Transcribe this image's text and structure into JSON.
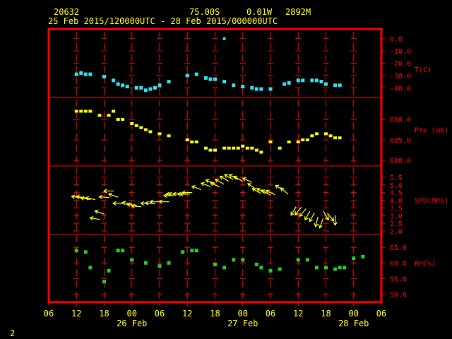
{
  "header": {
    "station": "20632",
    "lat": "75.00S",
    "lon": "0.01W",
    "alt": "2892M",
    "period": "25 Feb 2015/120000UTC - 28 Feb 2015/000000UTC"
  },
  "footer_label": "2",
  "colors": {
    "frame": "#ff0000",
    "grid": "#ff0000",
    "axis_text": "#ff0000",
    "header_text": "#ffff00",
    "temp": "#33ddee",
    "pres": "#ffff00",
    "wind": "#ffff00",
    "rh": "#22cc22"
  },
  "chart_data": {
    "type": "scatter",
    "x_hours": [
      -18,
      -12,
      -6,
      0,
      6,
      12,
      18,
      24,
      30,
      36,
      42,
      48,
      54
    ],
    "x_tick_labels": [
      "06",
      "12",
      "18",
      "00",
      "06",
      "12",
      "18",
      "00",
      "06",
      "12",
      "18",
      "00",
      "06"
    ],
    "date_labels": [
      {
        "hours": 0,
        "text": "26 Feb"
      },
      {
        "hours": 24,
        "text": "27 Feb"
      },
      {
        "hours": 48,
        "text": "28 Feb"
      }
    ],
    "panels": [
      {
        "label": "T(C)",
        "ylim": [
          -45,
          5
        ],
        "ticks": [
          0.0,
          -10.0,
          -20.0,
          -30.0,
          -40.0
        ],
        "series": {
          "x": [
            -12,
            -11,
            -10,
            -9,
            -6,
            -4,
            -3,
            -2,
            -1,
            1,
            2,
            3,
            4,
            5,
            6,
            8,
            12,
            14,
            16,
            17,
            18,
            20,
            22,
            24,
            26,
            27,
            28,
            30,
            33,
            34,
            36,
            37,
            39,
            40,
            41,
            42,
            44,
            45
          ],
          "y": [
            -29,
            -28,
            -29,
            -29,
            -31,
            -34,
            -37,
            -38,
            -39,
            -40,
            -40,
            -42,
            -41,
            -40,
            -38,
            -35,
            -30,
            -29,
            -32,
            -33,
            -33,
            -35,
            -38,
            -39,
            -40,
            -41,
            -41,
            -41,
            -37,
            -36,
            -34,
            -34,
            -34,
            -34,
            -35,
            -37,
            -38,
            -38
          ]
        },
        "outlier": {
          "x": 20,
          "y": 0
        }
      },
      {
        "label": "Pre (mb)",
        "ylim": [
          679.5,
          694.5
        ],
        "ticks": [
          690.0,
          685.0,
          680.0
        ],
        "series": {
          "x": [
            -12,
            -11,
            -10,
            -9,
            -7,
            -5,
            -4,
            -3,
            -2,
            0,
            1,
            2,
            3,
            4,
            6,
            8,
            12,
            13,
            14,
            16,
            17,
            18,
            20,
            21,
            22,
            23,
            24,
            25,
            26,
            27,
            28,
            30,
            32,
            34,
            36,
            37,
            38,
            39,
            40,
            42,
            43,
            44,
            45
          ],
          "y": [
            692,
            692,
            692,
            692,
            691,
            691,
            692,
            690,
            690,
            689,
            688.5,
            688,
            687.5,
            687,
            686.5,
            686,
            685,
            684.5,
            684.5,
            683,
            682.5,
            682.5,
            683,
            683,
            683,
            683,
            683.5,
            683,
            683,
            682.5,
            682,
            684.5,
            683,
            684.5,
            684.5,
            685,
            685,
            686,
            686.5,
            686.5,
            686,
            685.5,
            685.5
          ]
        }
      },
      {
        "label": "SPD(MPS)",
        "ylim": [
          2.0,
          6.0
        ],
        "ticks": [
          5.5,
          5.0,
          4.5,
          4.0,
          3.5,
          3.0,
          2.5,
          2.0
        ],
        "wind_note": "direction_deg = direction the wind blows from (meteorological)",
        "series": {
          "x": [
            -12,
            -11,
            -10,
            -9,
            -8,
            -7,
            -6,
            -5,
            -4,
            -3,
            -1,
            0,
            1,
            3,
            4,
            5,
            7,
            8,
            8.5,
            9,
            10,
            11,
            11.5,
            12,
            14,
            16,
            17,
            18,
            19,
            20,
            21,
            22,
            23,
            25,
            26,
            27,
            28,
            29,
            30,
            32,
            33,
            35,
            36,
            37,
            38,
            39,
            40,
            41,
            42,
            43,
            44
          ],
          "y": [
            4.2,
            4.2,
            4.1,
            4.1,
            2.8,
            3.2,
            4.2,
            4.6,
            4.3,
            3.8,
            3.8,
            3.7,
            3.6,
            3.8,
            3.8,
            3.9,
            3.9,
            4.3,
            4.4,
            4.4,
            4.4,
            4.4,
            4.4,
            4.5,
            4.8,
            5.0,
            5.2,
            5.0,
            5.2,
            5.4,
            5.5,
            5.5,
            5.4,
            5.3,
            4.9,
            4.6,
            4.6,
            4.5,
            4.5,
            4.8,
            4.6,
            3.3,
            3.3,
            3.2,
            3.0,
            2.9,
            2.6,
            2.5,
            3.0,
            2.9,
            2.7
          ],
          "direction_deg": [
            100,
            100,
            100,
            100,
            100,
            110,
            95,
            90,
            110,
            90,
            100,
            95,
            95,
            90,
            95,
            90,
            90,
            90,
            90,
            90,
            90,
            90,
            90,
            90,
            110,
            110,
            110,
            115,
            120,
            120,
            120,
            120,
            120,
            115,
            125,
            120,
            120,
            120,
            115,
            120,
            130,
            30,
            40,
            40,
            30,
            30,
            15,
            20,
            330,
            320,
            0
          ]
        }
      },
      {
        "label": "RH(%)",
        "ylim": [
          48.5,
          68.0
        ],
        "ticks": [
          65.0,
          60.0,
          55.0,
          50.0
        ],
        "series": {
          "x": [
            -12,
            -10,
            -9,
            -6,
            -5,
            -3,
            -2,
            0,
            3,
            6,
            8,
            11,
            13,
            14,
            18,
            20,
            22,
            24,
            27,
            28,
            30,
            32,
            36,
            38,
            40,
            42,
            44,
            45,
            46,
            48,
            50
          ],
          "y": [
            64,
            63.5,
            58.5,
            54,
            57.5,
            64,
            64,
            61,
            60,
            59,
            60,
            63.5,
            64,
            64,
            59.5,
            58.5,
            61,
            61,
            59.5,
            58.5,
            57.5,
            58,
            61,
            61,
            58.5,
            58.5,
            58,
            58.5,
            58.5,
            61.5,
            62
          ]
        }
      }
    ]
  }
}
